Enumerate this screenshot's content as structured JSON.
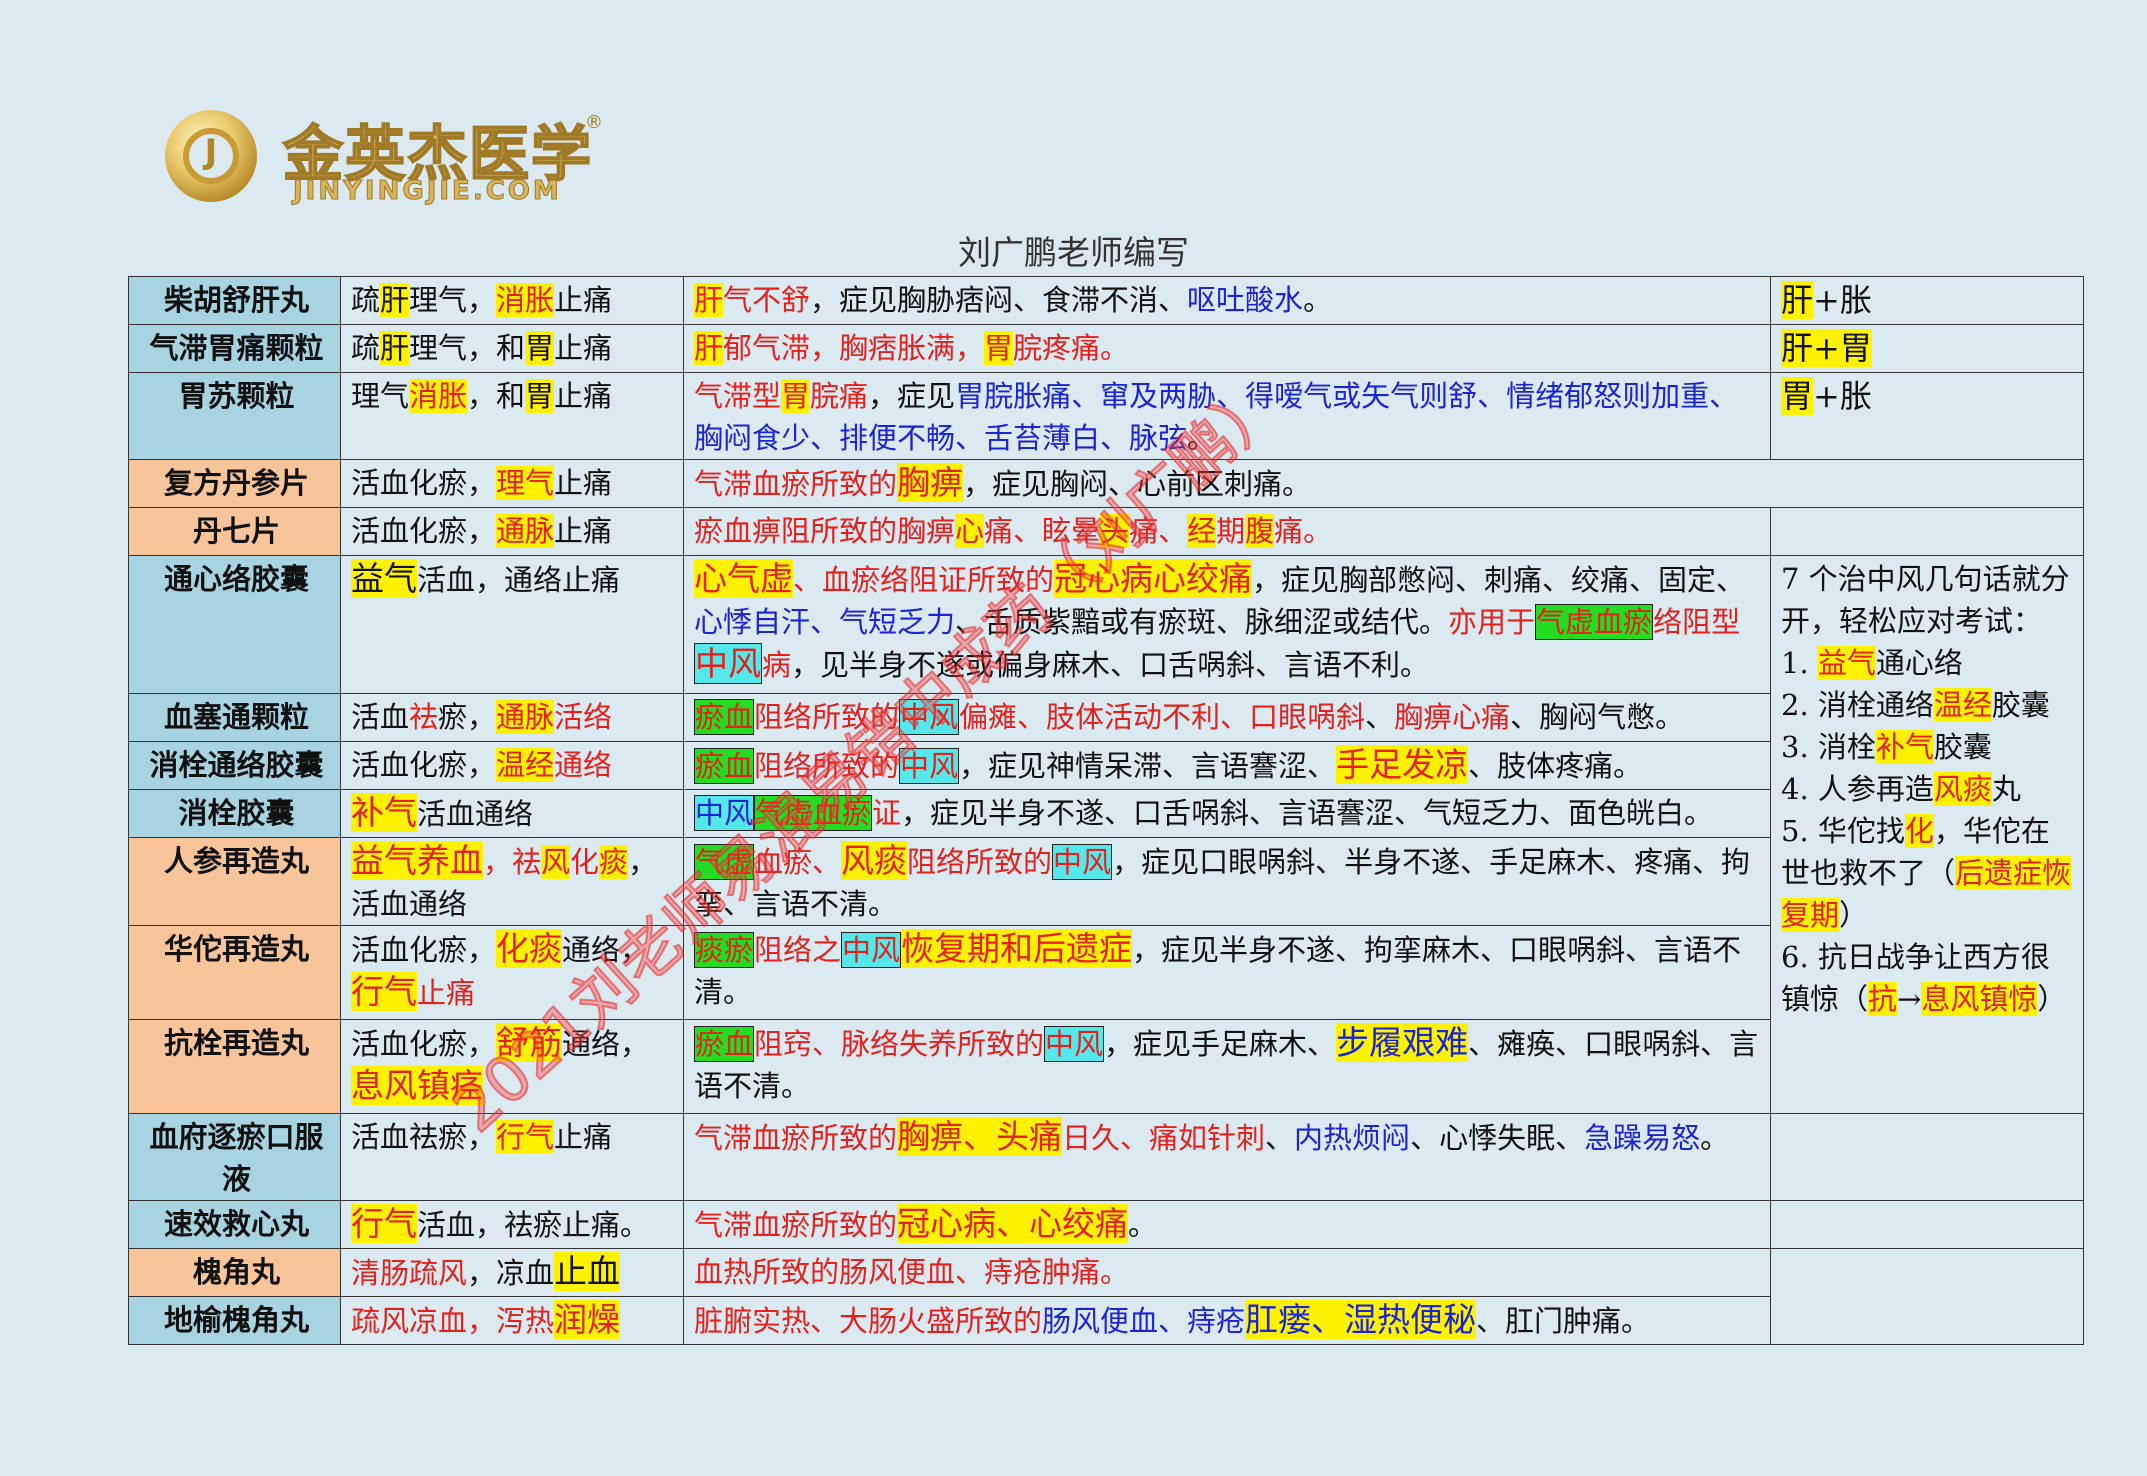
{
  "logo": {
    "cn": "金英杰医学",
    "en": "JINYINGJIE.COM",
    "reg": "®"
  },
  "author": "刘广鹏老师编写",
  "watermark": "2021刘老师易混易错中成药（刘广鹏）",
  "rows": [
    {
      "name": "柴胡舒肝丸",
      "band": "blue",
      "effect": [
        {
          "t": "疏"
        },
        {
          "t": "肝",
          "c": "y"
        },
        {
          "t": "理气，"
        },
        {
          "t": "消胀",
          "c": "r y"
        },
        {
          "t": "止痛"
        }
      ],
      "desc": [
        {
          "t": "肝",
          "c": "r y"
        },
        {
          "t": "气不舒",
          "c": "r"
        },
        {
          "t": "，症见胸胁痞闷、食滞不消、"
        },
        {
          "t": "呕吐酸水",
          "c": "b"
        },
        {
          "t": "。"
        }
      ],
      "tag": [
        {
          "t": "肝",
          "c": "y"
        },
        {
          "t": "+胀"
        }
      ]
    },
    {
      "name": "气滞胃痛颗粒",
      "band": "blue",
      "effect": [
        {
          "t": "疏"
        },
        {
          "t": "肝",
          "c": "y"
        },
        {
          "t": "理气，和"
        },
        {
          "t": "胃",
          "c": "y"
        },
        {
          "t": "止痛"
        }
      ],
      "desc": [
        {
          "t": "肝",
          "c": "r y"
        },
        {
          "t": "郁气滞，胸痞胀满，",
          "c": "r"
        },
        {
          "t": "胃",
          "c": "r y"
        },
        {
          "t": "脘疼痛。",
          "c": "r"
        }
      ],
      "tag": [
        {
          "t": "肝+胃",
          "c": "y"
        }
      ]
    },
    {
      "name": "胃苏颗粒",
      "band": "blue",
      "effect": [
        {
          "t": "理气"
        },
        {
          "t": "消胀",
          "c": "r y"
        },
        {
          "t": "，和"
        },
        {
          "t": "胃",
          "c": "y"
        },
        {
          "t": "止痛"
        }
      ],
      "desc": [
        {
          "t": "气滞型",
          "c": "r"
        },
        {
          "t": "胃",
          "c": "r y"
        },
        {
          "t": "脘痛",
          "c": "r"
        },
        {
          "t": "，症见"
        },
        {
          "t": "胃脘胀痛、窜及两胁、得嗳气或矢气则舒、情绪郁怒则加重、胸闷食少、排便不畅、舌苔薄白、脉弦",
          "c": "b"
        },
        {
          "t": "。"
        }
      ],
      "tag": [
        {
          "t": "胃",
          "c": "y"
        },
        {
          "t": "+胀"
        }
      ]
    },
    {
      "name": "复方丹参片",
      "band": "orange",
      "effect": [
        {
          "t": "活血化瘀，"
        },
        {
          "t": "理气",
          "c": "r y"
        },
        {
          "t": "止痛"
        }
      ],
      "desc": [
        {
          "t": "气滞血瘀所致的",
          "c": "r"
        },
        {
          "t": "胸痹",
          "c": "r y big"
        },
        {
          "t": "，症见胸闷、心前区刺痛。"
        }
      ]
    },
    {
      "name": "丹七片",
      "band": "orange",
      "effect": [
        {
          "t": "活血化瘀，"
        },
        {
          "t": "通脉",
          "c": "r y"
        },
        {
          "t": "止痛"
        }
      ],
      "desc": [
        {
          "t": "瘀血痹阻所致的",
          "c": "r"
        },
        {
          "t": "胸痹",
          "c": "r"
        },
        {
          "t": "心",
          "c": "r y"
        },
        {
          "t": "痛、眩晕",
          "c": "r"
        },
        {
          "t": "头",
          "c": "r y"
        },
        {
          "t": "痛、",
          "c": "r"
        },
        {
          "t": "经",
          "c": "r y"
        },
        {
          "t": "期",
          "c": "r"
        },
        {
          "t": "腹",
          "c": "r y"
        },
        {
          "t": "痛。",
          "c": "r"
        }
      ]
    },
    {
      "name": "通心络胶囊",
      "band": "blue",
      "effect": [
        {
          "t": "益气",
          "c": "y big"
        },
        {
          "t": "活血，通络止痛"
        }
      ],
      "desc": [
        {
          "t": "心气虚",
          "c": "r y big"
        },
        {
          "t": "、血瘀络阻证所致的",
          "c": "r"
        },
        {
          "t": "冠心病心绞痛",
          "c": "r y big"
        },
        {
          "t": "，症见胸部憋闷、刺痛、绞痛、固定、"
        },
        {
          "t": "心悸自汗、气短乏力",
          "c": "b"
        },
        {
          "t": "、舌质紫黯或有瘀斑、脉细涩或结代。"
        },
        {
          "t": "亦用于",
          "c": "r"
        },
        {
          "t": "气虚血瘀",
          "c": "r g"
        },
        {
          "t": "络阻型",
          "c": "r"
        },
        {
          "t": "中风",
          "c": "r c big"
        },
        {
          "t": "病",
          "c": "r"
        },
        {
          "t": "，见半身不遂或偏身麻木、口舌㖞斜、言语不利。"
        }
      ]
    },
    {
      "name": "血塞通颗粒",
      "band": "blue",
      "effect": [
        {
          "t": "活血"
        },
        {
          "t": "祛",
          "c": "r"
        },
        {
          "t": "瘀，"
        },
        {
          "t": "通脉",
          "c": "r y"
        },
        {
          "t": "活络",
          "c": "r"
        }
      ],
      "desc": [
        {
          "t": "瘀血",
          "c": "r g"
        },
        {
          "t": "阻络所致的",
          "c": "r"
        },
        {
          "t": "中风",
          "c": "r c"
        },
        {
          "t": "偏瘫、肢体活动不利、口眼㖞斜",
          "c": "r"
        },
        {
          "t": "、"
        },
        {
          "t": "胸痹心痛",
          "c": "r"
        },
        {
          "t": "、胸闷气憋。"
        }
      ]
    },
    {
      "name": "消栓通络胶囊",
      "band": "blue",
      "effect": [
        {
          "t": "活血化瘀，"
        },
        {
          "t": "温经",
          "c": "r y"
        },
        {
          "t": "通络",
          "c": "r"
        }
      ],
      "desc": [
        {
          "t": "瘀血",
          "c": "r g"
        },
        {
          "t": "阻络所致的",
          "c": "r"
        },
        {
          "t": "中风",
          "c": "r c"
        },
        {
          "t": "，症见神情呆滞、言语謇涩、"
        },
        {
          "t": "手足发凉",
          "c": "r y big"
        },
        {
          "t": "、肢体疼痛。"
        }
      ]
    },
    {
      "name": "消栓胶囊",
      "band": "blue",
      "effect": [
        {
          "t": "补气",
          "c": "r y big"
        },
        {
          "t": "活血通络"
        }
      ],
      "desc": [
        {
          "t": "中风",
          "c": "b c"
        },
        {
          "t": "气虚血瘀",
          "c": "r g"
        },
        {
          "t": "证",
          "c": "r"
        },
        {
          "t": "，症见半身不遂、口舌㖞斜、言语謇涩、气短乏力、面色㿠白。"
        }
      ]
    },
    {
      "name": "人参再造丸",
      "band": "orange",
      "effect": [
        {
          "t": "益气养血",
          "c": "r y big"
        },
        {
          "t": "，祛",
          "c": "r"
        },
        {
          "t": "风",
          "c": "r y"
        },
        {
          "t": "化",
          "c": "r"
        },
        {
          "t": "痰",
          "c": "r y"
        },
        {
          "t": "，活血通络"
        }
      ],
      "desc": [
        {
          "t": "气虚",
          "c": "r g"
        },
        {
          "t": "血瘀、",
          "c": "r"
        },
        {
          "t": "风痰",
          "c": "r y big"
        },
        {
          "t": "阻络所致的",
          "c": "r"
        },
        {
          "t": "中风",
          "c": "r c"
        },
        {
          "t": "，症见口眼㖞斜、半身不遂、手足麻木、疼痛、拘挛、言语不清。"
        }
      ]
    },
    {
      "name": "华佗再造丸",
      "band": "orange",
      "effect": [
        {
          "t": "活血化瘀，"
        },
        {
          "t": "化痰",
          "c": "r y big"
        },
        {
          "t": "通络，"
        },
        {
          "t": "行气",
          "c": "r y big"
        },
        {
          "t": "止痛",
          "c": "r"
        }
      ],
      "desc": [
        {
          "t": "痰瘀",
          "c": "r g"
        },
        {
          "t": "阻络之",
          "c": "r"
        },
        {
          "t": "中风",
          "c": "r c"
        },
        {
          "t": "恢复期和后遗症",
          "c": "r y big"
        },
        {
          "t": "，症见半身不遂、拘挛麻木、口眼㖞斜、言语不清。"
        }
      ]
    },
    {
      "name": "抗栓再造丸",
      "band": "orange",
      "effect": [
        {
          "t": "活血化瘀，"
        },
        {
          "t": "舒筋",
          "c": "r y big"
        },
        {
          "t": "通络，"
        },
        {
          "t": "息风镇痉",
          "c": "r y big"
        }
      ],
      "desc": [
        {
          "t": "瘀血",
          "c": "r g"
        },
        {
          "t": "阻窍、脉络失养所致的",
          "c": "r"
        },
        {
          "t": "中风",
          "c": "r c"
        },
        {
          "t": "，症见手足麻木、"
        },
        {
          "t": "步履艰难",
          "c": "b y big"
        },
        {
          "t": "、瘫痪、口眼㖞斜、言语不清。"
        }
      ]
    },
    {
      "name": "血府逐瘀口服液",
      "band": "blue",
      "effect": [
        {
          "t": "活血祛瘀，"
        },
        {
          "t": "行气",
          "c": "r y"
        },
        {
          "t": "止痛"
        }
      ],
      "desc": [
        {
          "t": "气滞血瘀所致的",
          "c": "r"
        },
        {
          "t": "胸痹、头痛",
          "c": "r y big"
        },
        {
          "t": "日久、痛如针刺",
          "c": "r"
        },
        {
          "t": "、"
        },
        {
          "t": "内热烦闷",
          "c": "b"
        },
        {
          "t": "、心悸失眠、"
        },
        {
          "t": "急躁易怒",
          "c": "b"
        },
        {
          "t": "。"
        }
      ]
    },
    {
      "name": "速效救心丸",
      "band": "blue",
      "effect": [
        {
          "t": "行气",
          "c": "r y big"
        },
        {
          "t": "活血，祛瘀止痛。"
        }
      ],
      "desc": [
        {
          "t": "气滞血瘀所致的",
          "c": "r"
        },
        {
          "t": "冠心病、心绞痛",
          "c": "r y big"
        },
        {
          "t": "。"
        }
      ]
    },
    {
      "name": "槐角丸",
      "band": "orange",
      "effect": [
        {
          "t": "清肠疏风",
          "c": "r"
        },
        {
          "t": "，凉血"
        },
        {
          "t": "止血",
          "c": "y big"
        }
      ],
      "desc": [
        {
          "t": "血热所致的肠风便血、痔疮肿痛。",
          "c": "r"
        }
      ]
    },
    {
      "name": "地榆槐角丸",
      "band": "blue",
      "effect": [
        {
          "t": "疏风凉血，泻热",
          "c": "r"
        },
        {
          "t": "润燥",
          "c": "r y big"
        }
      ],
      "desc": [
        {
          "t": "脏腑实热、大肠火盛所致的",
          "c": "r"
        },
        {
          "t": "肠风便血、痔疮",
          "c": "b"
        },
        {
          "t": "肛瘘、湿热便秘",
          "c": "b y big"
        },
        {
          "t": "、肛门肿痛。"
        }
      ]
    }
  ],
  "note": {
    "lines": [
      [
        {
          "t": "7 个治中风几句话就分开，轻松应对考试："
        }
      ],
      [
        {
          "t": "1. "
        },
        {
          "t": "益气",
          "c": "r y"
        },
        {
          "t": "通心络"
        }
      ],
      [
        {
          "t": "2. 消栓通络"
        },
        {
          "t": "温经",
          "c": "r y"
        },
        {
          "t": "胶囊"
        }
      ],
      [
        {
          "t": "3. 消栓"
        },
        {
          "t": "补气",
          "c": "r y"
        },
        {
          "t": "胶囊"
        }
      ],
      [
        {
          "t": "4. 人参再造"
        },
        {
          "t": "风痰",
          "c": "r y"
        },
        {
          "t": "丸"
        }
      ],
      [
        {
          "t": "5. 华佗找"
        },
        {
          "t": "化",
          "c": "r y"
        },
        {
          "t": "，华佗在世也救不了（"
        },
        {
          "t": "后遗症恢复期",
          "c": "r y"
        },
        {
          "t": "）"
        }
      ],
      [
        {
          "t": "6. 抗日战争让西方很镇惊（"
        },
        {
          "t": "抗",
          "c": "r y"
        },
        {
          "t": "→"
        },
        {
          "t": "息风镇惊",
          "c": "r y"
        },
        {
          "t": "）"
        }
      ]
    ]
  }
}
